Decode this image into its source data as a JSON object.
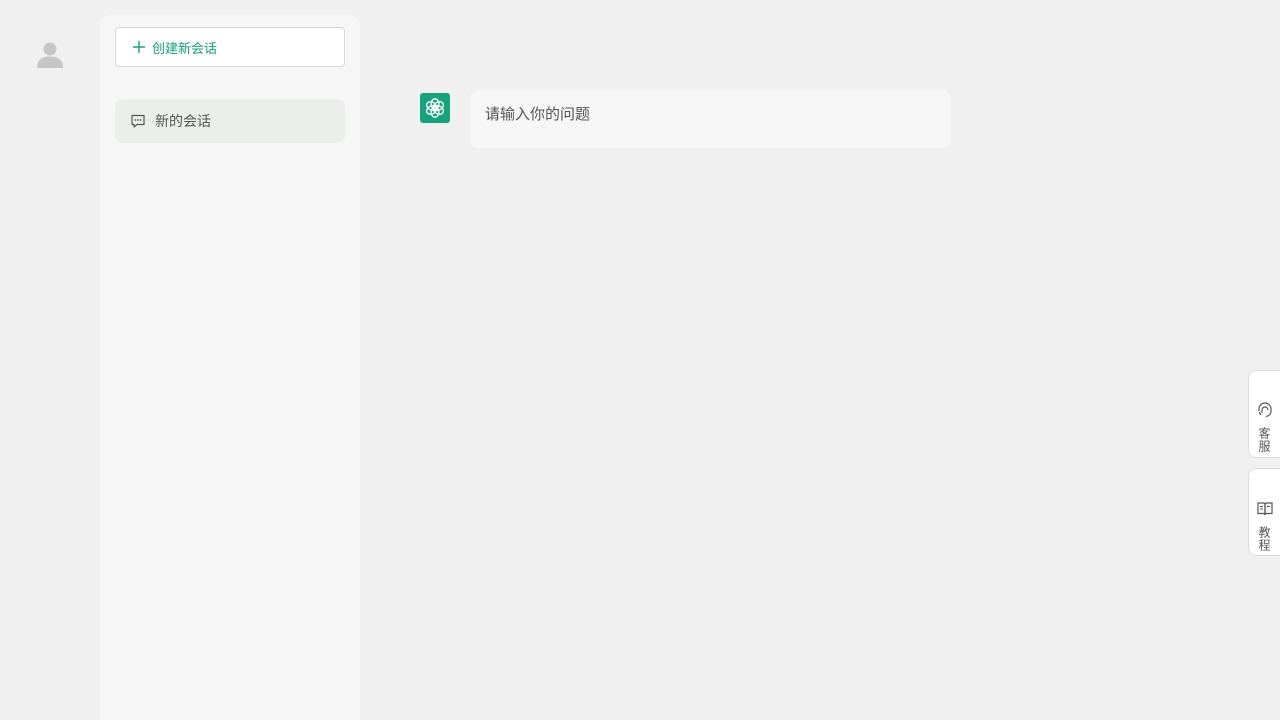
{
  "sidebar": {
    "new_chat_label": "创建新会话",
    "conversations": [
      {
        "label": "新的会话"
      }
    ]
  },
  "chat": {
    "input_placeholder": "请输入你的问题"
  },
  "side_tabs": {
    "service_label": "客服",
    "tutorial_label": "教程"
  },
  "colors": {
    "accent": "#16a37c",
    "background": "#eff0ef",
    "panel": "#f6f6f6"
  },
  "icons": {
    "user": "user-avatar-icon",
    "plus": "plus-icon",
    "chat": "chat-bubble-icon",
    "bot": "openai-logo-icon",
    "service": "headset-icon",
    "tutorial": "book-icon"
  }
}
